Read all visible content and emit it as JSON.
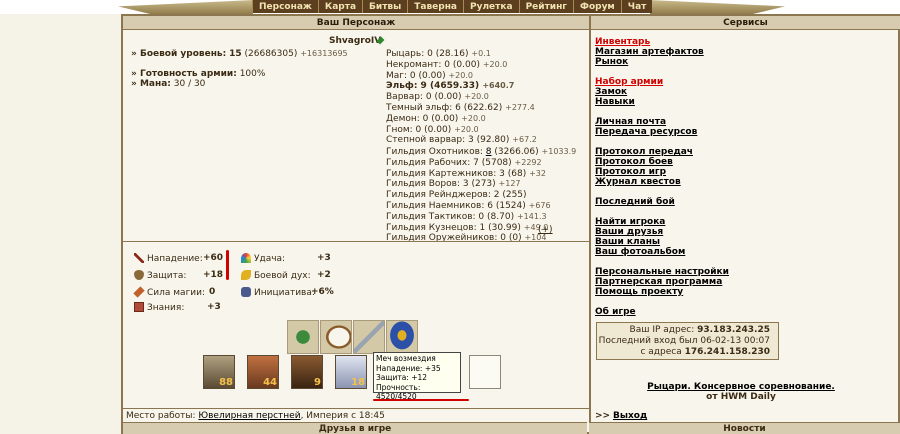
{
  "nav": [
    "Персонаж",
    "Карта",
    "Битвы",
    "Таверна",
    "Рулетка",
    "Рейтинг",
    "Форум",
    "Чат"
  ],
  "headers": {
    "character": "Ваш Персонаж",
    "services": "Сервисы",
    "friends": "Друзья в игре",
    "news": "Новости"
  },
  "player": {
    "name": "ShvagroIV",
    "level_label": "Боевой уровень:",
    "level_value": "15",
    "level_exp": "(26686305)",
    "level_gain": "+16313695",
    "army_label": "Готовность армии:",
    "army_value": "100%",
    "mana_label": "Мана:",
    "mana_value": "30 / 30"
  },
  "factions": [
    {
      "name": "Рыцарь: 0",
      "val": "(28.16)",
      "gain": "+0.1"
    },
    {
      "name": "Некромант: 0",
      "val": "(0.00)",
      "gain": "+20.0"
    },
    {
      "name": "Маг: 0",
      "val": "(0.00)",
      "gain": "+20.0"
    },
    {
      "name": "Эльф: 9",
      "val": "(4659.33)",
      "gain": "+640.7"
    },
    {
      "name": "Варвар: 0",
      "val": "(0.00)",
      "gain": "+20.0"
    },
    {
      "name": "Темный эльф: 6",
      "val": "(622.62)",
      "gain": "+277.4"
    },
    {
      "name": "Демон: 0",
      "val": "(0.00)",
      "gain": "+20.0"
    },
    {
      "name": "Гном: 0",
      "val": "(0.00)",
      "gain": "+20.0"
    },
    {
      "name": "Степной варвар: 3",
      "val": "(92.80)",
      "gain": "+67.2"
    }
  ],
  "guilds": [
    {
      "name": "Гильдия Охотников:",
      "lvl": "8",
      "val": "(3266.06)",
      "gain": "+1033.9"
    },
    {
      "name": "Гильдия Рабочих: 7",
      "lvl": "",
      "val": "(5708)",
      "gain": "+2292"
    },
    {
      "name": "Гильдия Картежников: 3",
      "lvl": "",
      "val": "(68)",
      "gain": "+32"
    },
    {
      "name": "Гильдия Воров: 3",
      "lvl": "",
      "val": "(273)",
      "gain": "+127"
    },
    {
      "name": "Гильдия Рейнджеров: 2",
      "lvl": "",
      "val": "(255)",
      "gain": ""
    },
    {
      "name": "Гильдия Наемников: 6",
      "lvl": "",
      "val": "(1524)",
      "gain": "+676"
    },
    {
      "name": "Гильдия Тактиков: 0",
      "lvl": "",
      "val": "(8.70)",
      "gain": "+141.3"
    },
    {
      "name": "Гильдия Кузнецов: 1",
      "lvl": "",
      "val": "(30.99)",
      "gain": "+49.0"
    },
    {
      "name": "Гильдия Оружейников: 0",
      "lvl": "",
      "val": "(0)",
      "gain": "+104"
    }
  ],
  "guild_plus": "(+)",
  "stats": {
    "attack_label": "Нападение:",
    "attack_value": "+60",
    "defense_label": "Защита:",
    "defense_value": "+18",
    "magic_label": "Сила магии:",
    "magic_value": "0",
    "knowledge_label": "Знания:",
    "knowledge_value": "+3",
    "luck_label": "Удача:",
    "luck_value": "+3",
    "morale_label": "Боевой дух:",
    "morale_value": "+2",
    "initiative_label": "Инициатива:",
    "initiative_value": "+6%"
  },
  "army": [
    "88",
    "44",
    "9",
    "18"
  ],
  "tooltip": {
    "title": "Меч возмездия",
    "attack": "Нападение:  +35",
    "defense": "Защита:  +12",
    "durability": "Прочность: 4520/4520"
  },
  "workplace": {
    "label": "Место работы:",
    "link": "Ювелирная перстней",
    "rest": ", Империя с 18:45"
  },
  "services": [
    {
      "label": "Инвентарь",
      "red": true
    },
    {
      "label": "Магазин артефактов"
    },
    {
      "label": "Рынок"
    },
    {
      "label": ""
    },
    {
      "label": "Набор армии",
      "red": true
    },
    {
      "label": "Замок"
    },
    {
      "label": "Навыки"
    },
    {
      "label": ""
    },
    {
      "label": "Личная почта"
    },
    {
      "label": "Передача ресурсов"
    },
    {
      "label": ""
    },
    {
      "label": "Протокол передач"
    },
    {
      "label": "Протокол боев"
    },
    {
      "label": "Протокол игр"
    },
    {
      "label": "Журнал квестов"
    },
    {
      "label": ""
    },
    {
      "label": "Последний бой"
    },
    {
      "label": ""
    },
    {
      "label": "Найти игрока"
    },
    {
      "label": "Ваши друзья"
    },
    {
      "label": "Ваши кланы"
    },
    {
      "label": "Ваш фотоальбом"
    },
    {
      "label": ""
    },
    {
      "label": "Персональные настройки"
    },
    {
      "label": "Партнерская программа"
    },
    {
      "label": "Помощь проекту"
    },
    {
      "label": ""
    },
    {
      "label": "Об игре"
    }
  ],
  "ip": {
    "line1_label": "Ваш IP адрес:",
    "line1_value": "93.183.243.25",
    "line2": "Последний вход был 06-02-13 00:07",
    "line3_label": "с адреса",
    "line3_value": "176.241.158.230"
  },
  "promo": {
    "line1": "Рыцари. Консервное соревнование.",
    "line2": "от HWM Daily"
  },
  "exit": {
    "prefix": ">>",
    "label": "Выход"
  },
  "colors": {
    "accent_red": "#d00000",
    "panel_bg": "#f8f6ec",
    "header_bg": "#d8ccb0",
    "border": "#8b7650"
  }
}
